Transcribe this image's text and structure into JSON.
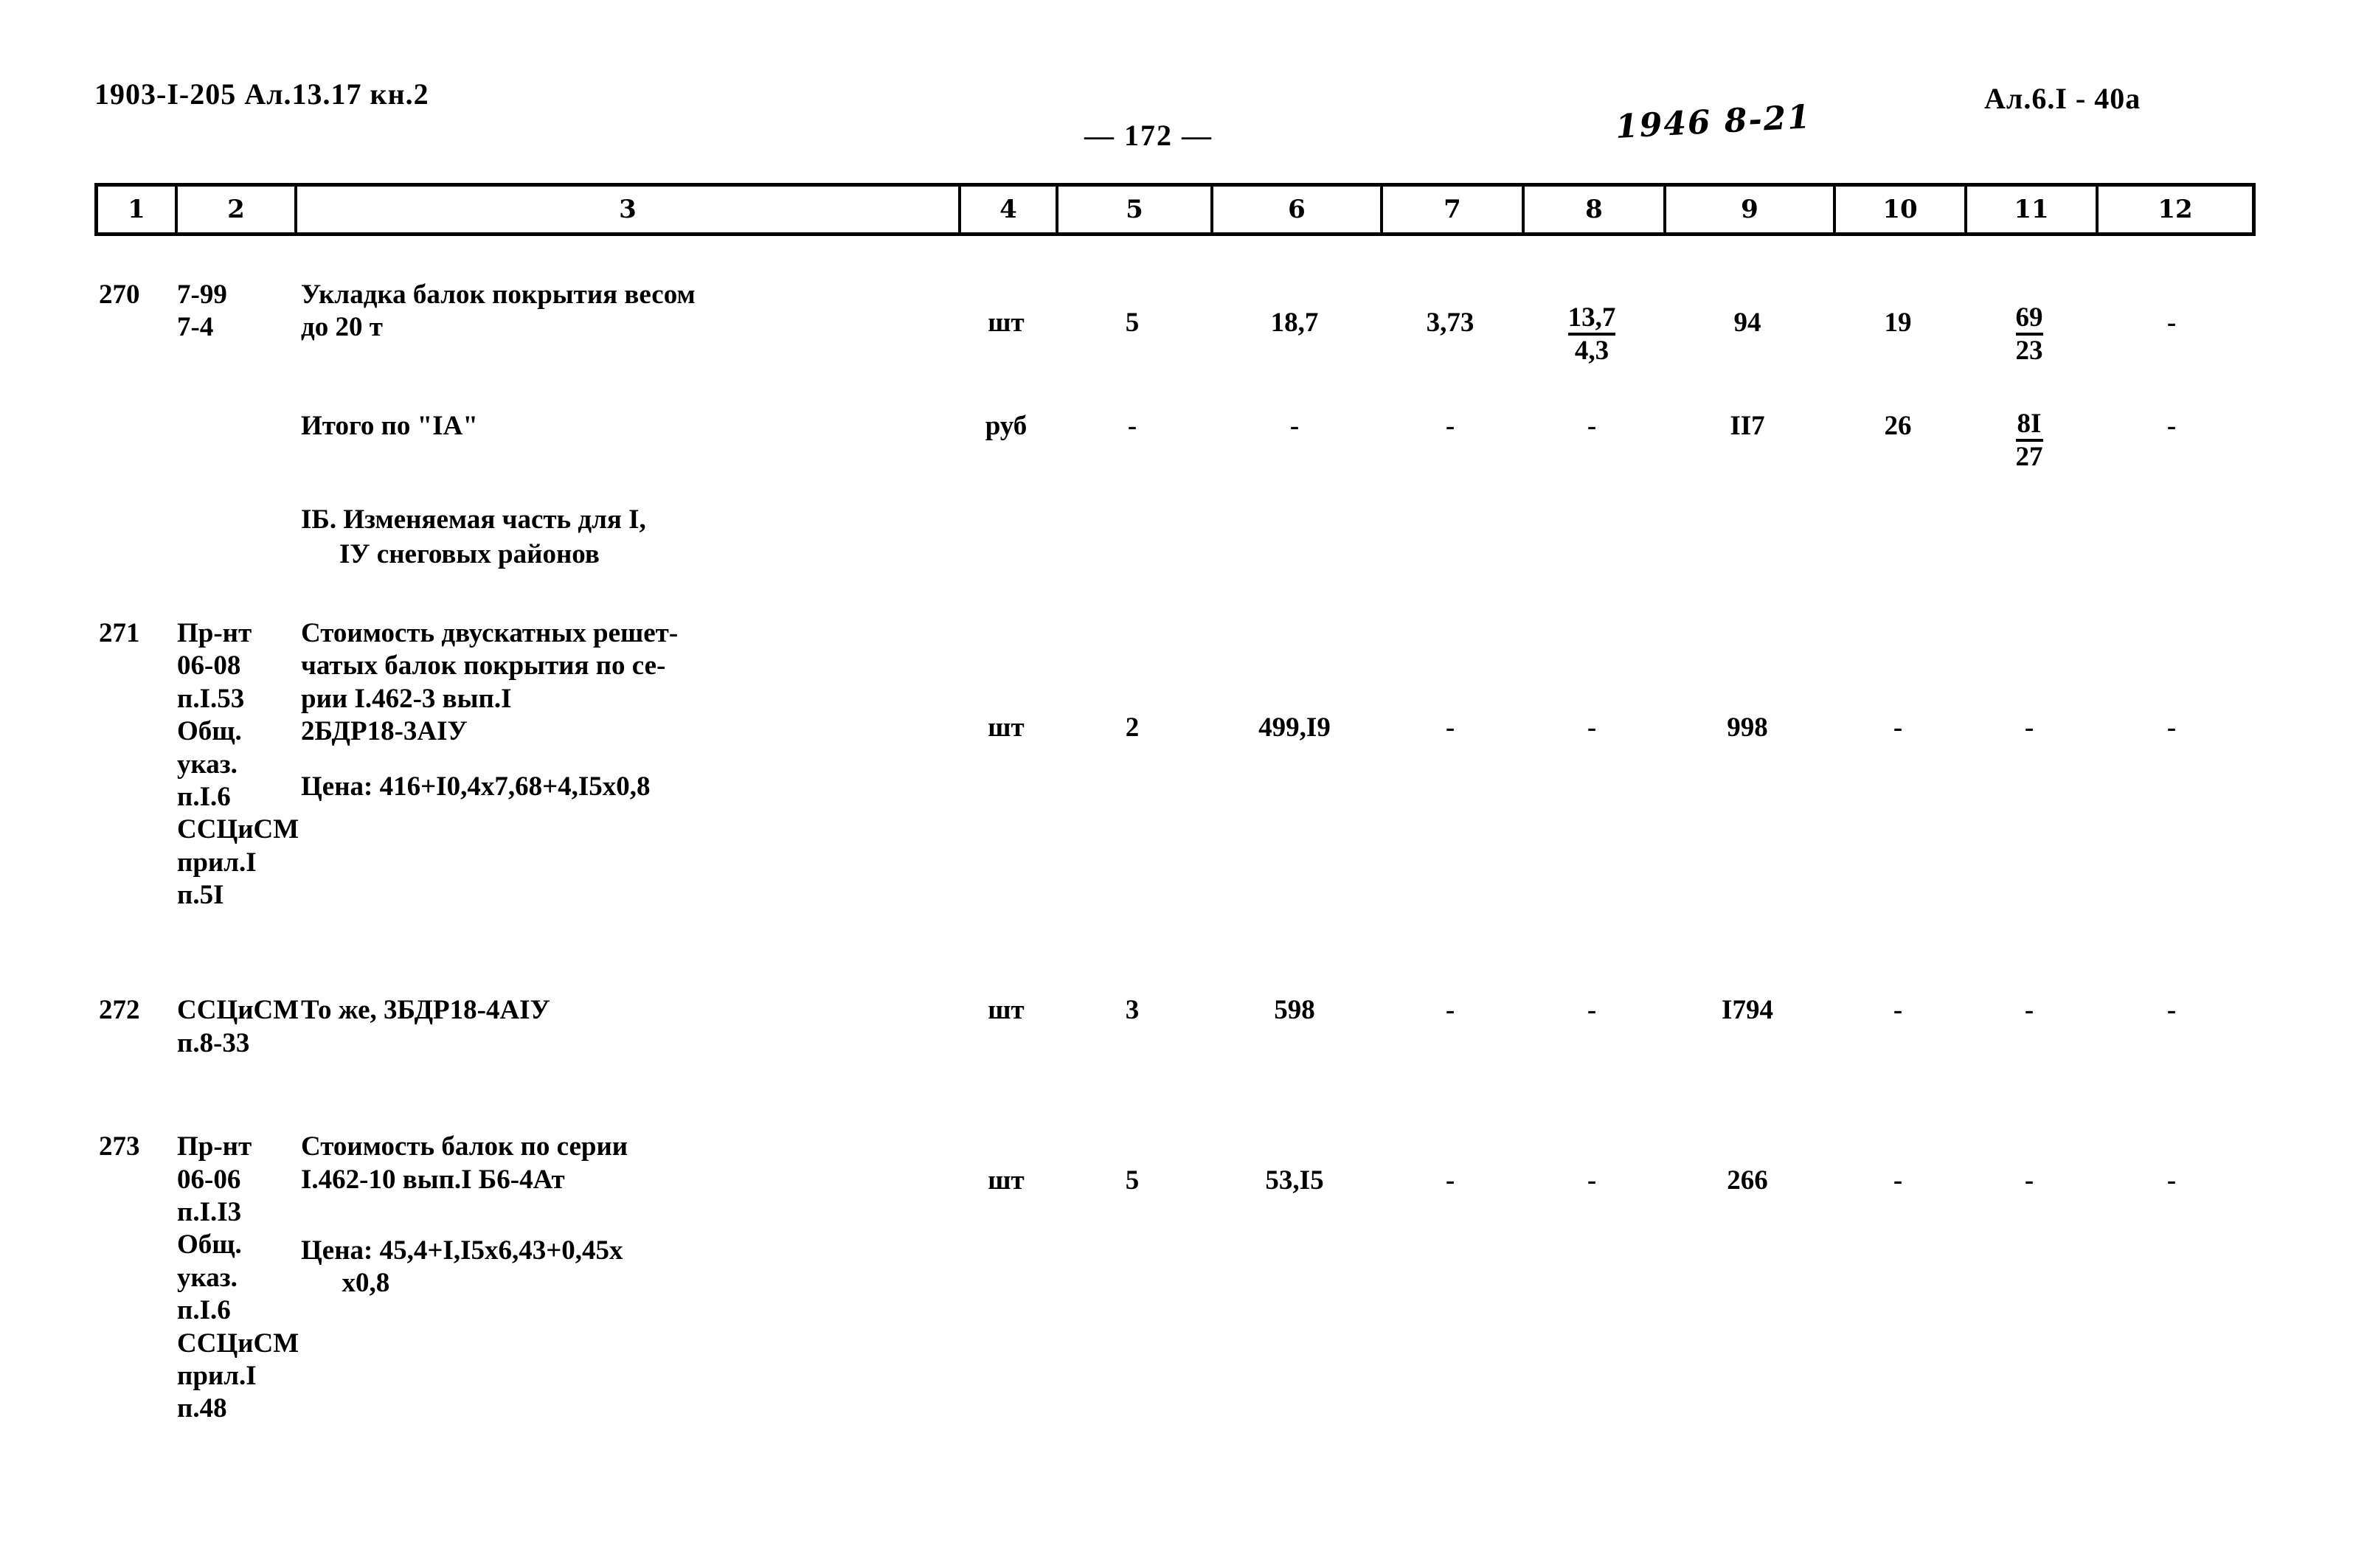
{
  "header": {
    "left_code": "1903-I-205 Ал.13.17 кн.2",
    "page_number": "— 172 —",
    "handwritten_note": "1946 8-21",
    "right_code": "Ал.6.I - 40а"
  },
  "table": {
    "column_headers": [
      "1",
      "2",
      "3",
      "4",
      "5",
      "6",
      "7",
      "8",
      "9",
      "10",
      "11",
      "12"
    ],
    "rows": [
      {
        "num": "270",
        "ref": "7-99\n7-4",
        "desc": "Укладка балок покрытия весом\nдо 20 т",
        "unit": "шт",
        "c5": "5",
        "c6": "18,7",
        "c7": "3,73",
        "c8_num": "13,7",
        "c8_den": "4,3",
        "c9": "94",
        "c10": "19",
        "c11_num": "69",
        "c11_den": "23",
        "c12": "-"
      },
      {
        "num": "",
        "ref": "",
        "desc": "Итого по \"IА\"",
        "unit": "руб",
        "c5": "-",
        "c6": "-",
        "c7": "-",
        "c8": "-",
        "c9": "II7",
        "c10": "26",
        "c11_num": "8I",
        "c11_den": "27",
        "c12": "-"
      }
    ],
    "section_heading": {
      "line1": "IБ. Изменяемая часть для I,",
      "line2": "IУ снеговых районов"
    },
    "rows2": [
      {
        "num": "271",
        "ref": "Пр-нт\n06-08\nп.I.53\nОбщ.\nуказ.\nп.I.6\nССЦиСМ\nприл.I\nп.5I",
        "desc_top": "Стоимость двускатных решет-\nчатых балок покрытия по се-\nрии I.462-3 вып.I\n2БДР18-3АIУ",
        "desc_price": "Цена: 416+I0,4x7,68+4,I5x0,8",
        "unit": "шт",
        "c5": "2",
        "c6": "499,I9",
        "c7": "-",
        "c8": "-",
        "c9": "998",
        "c10": "-",
        "c11": "-",
        "c12": "-"
      },
      {
        "num": "272",
        "ref": "ССЦиСМ\nп.8-33",
        "desc_top": "То же, 3БДР18-4АIУ",
        "desc_price": "",
        "unit": "шт",
        "c5": "3",
        "c6": "598",
        "c7": "-",
        "c8": "-",
        "c9": "I794",
        "c10": "-",
        "c11": "-",
        "c12": "-"
      },
      {
        "num": "273",
        "ref": "Пр-нт\n06-06\nп.I.I3\nОбщ.\nуказ.\nп.I.6\nССЦиСМ\nприл.I\nп.48",
        "desc_top": "Стоимость балок по серии\nI.462-10 вып.I Б6-4Ат",
        "desc_price": "Цена: 45,4+I,I5x6,43+0,45x\n      x0,8",
        "unit": "шт",
        "c5": "5",
        "c6": "53,I5",
        "c7": "-",
        "c8": "-",
        "c9": "266",
        "c10": "-",
        "c11": "-",
        "c12": "-"
      }
    ]
  }
}
